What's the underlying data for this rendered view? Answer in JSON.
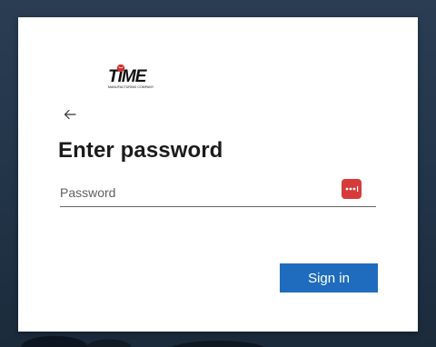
{
  "logo": {
    "text": "TIME",
    "subtext": "MANUFACTURING COMPANY",
    "brand_color": "#d32f2f"
  },
  "back": {
    "icon": "back-arrow-icon"
  },
  "page": {
    "title": "Enter password"
  },
  "password": {
    "placeholder": "Password",
    "value": "",
    "manager_icon": "password-manager-icon",
    "manager_color": "#d63a3a"
  },
  "actions": {
    "signin_label": "Sign in",
    "accent": "#1f6cbf"
  }
}
